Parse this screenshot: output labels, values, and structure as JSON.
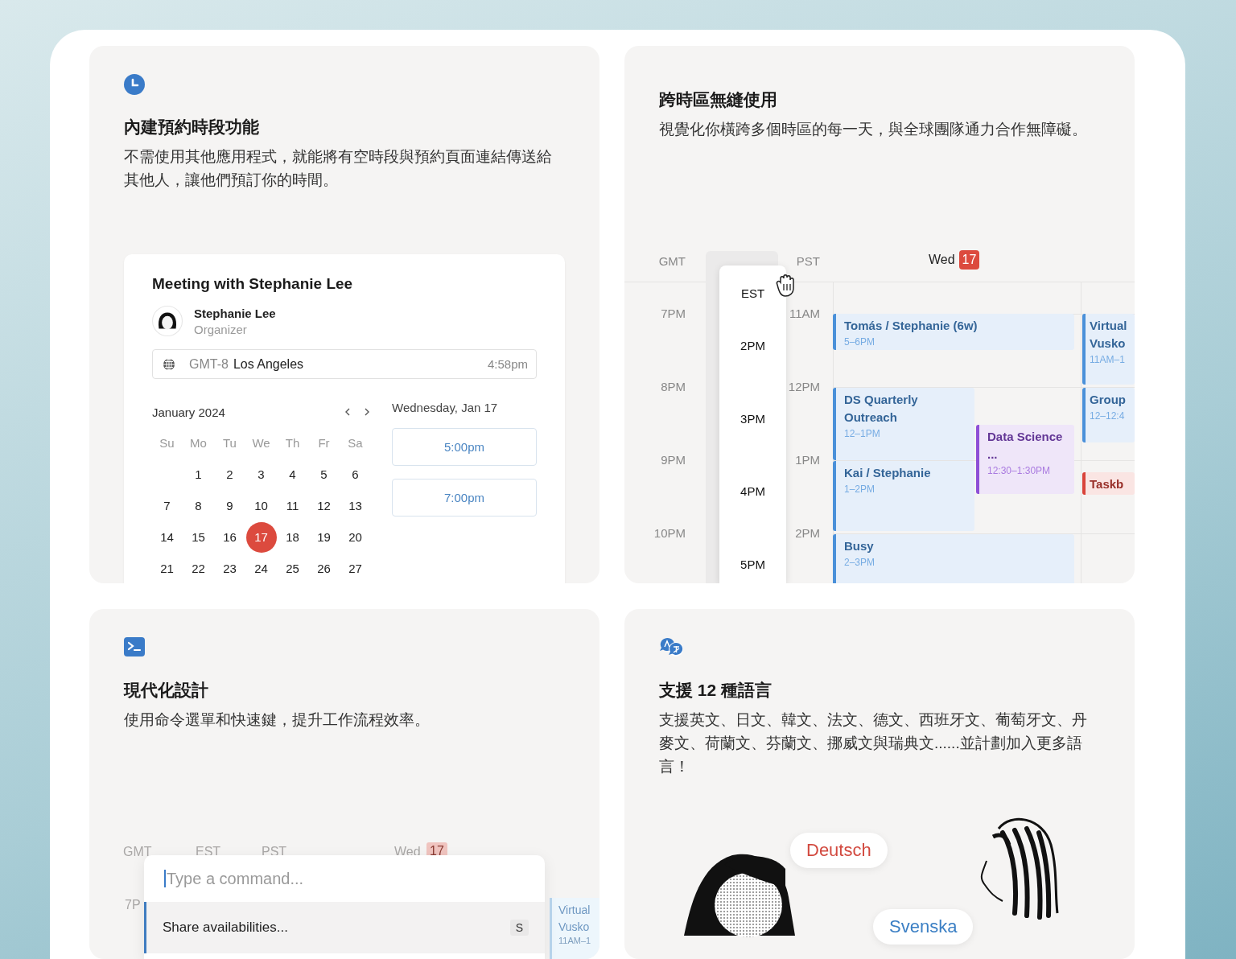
{
  "booking": {
    "title": "內建預約時段功能",
    "description": "不需使用其他應用程式，就能將有空時段與預約頁面連結傳送給其他人，讓他們預訂你的時間。",
    "widget": {
      "title": "Meeting with Stephanie Lee",
      "organizer": {
        "name": "Stephanie Lee",
        "role": "Organizer"
      },
      "timezone": {
        "offset": "GMT-8",
        "city": "Los Angeles",
        "time": "4:58pm"
      },
      "month": "January 2024",
      "weekdays": [
        "Su",
        "Mo",
        "Tu",
        "We",
        "Th",
        "Fr",
        "Sa"
      ],
      "weeks": [
        [
          {
            "label": "1",
            "selected": false
          },
          {
            "label": "2",
            "selected": false
          },
          {
            "label": "3",
            "selected": false
          },
          {
            "label": "4",
            "selected": false
          },
          {
            "label": "5",
            "selected": false
          },
          {
            "label": "6",
            "selected": false
          }
        ],
        [
          {
            "label": "7",
            "selected": false
          },
          {
            "label": "8",
            "selected": false
          },
          {
            "label": "9",
            "selected": false
          },
          {
            "label": "10",
            "selected": false
          },
          {
            "label": "11",
            "selected": false
          },
          {
            "label": "12",
            "selected": false
          },
          {
            "label": "13",
            "selected": false
          }
        ],
        [
          {
            "label": "14",
            "selected": false
          },
          {
            "label": "15",
            "selected": false
          },
          {
            "label": "16",
            "selected": false
          },
          {
            "label": "17",
            "selected": true
          },
          {
            "label": "18",
            "selected": false
          },
          {
            "label": "19",
            "selected": false
          },
          {
            "label": "20",
            "selected": false
          }
        ],
        [
          {
            "label": "21",
            "selected": false
          },
          {
            "label": "22",
            "selected": false
          },
          {
            "label": "23",
            "selected": false
          },
          {
            "label": "24",
            "selected": false
          },
          {
            "label": "25",
            "selected": false
          },
          {
            "label": "26",
            "selected": false
          },
          {
            "label": "27",
            "selected": false
          }
        ]
      ],
      "date_heading": "Wednesday, Jan 17",
      "slots": [
        "5:00pm",
        "7:00pm"
      ]
    }
  },
  "timezones": {
    "title": "跨時區無縫使用",
    "description": "視覺化你橫跨多個時區的每一天，與全球團隊通力合作無障礙。",
    "calendar": {
      "gmt": {
        "label": "GMT",
        "hours": [
          "7PM",
          "8PM",
          "9PM",
          "10PM"
        ]
      },
      "est": {
        "label": "EST",
        "hours": [
          "2PM",
          "3PM",
          "4PM",
          "5PM"
        ]
      },
      "pst": {
        "label": "PST",
        "hours": [
          "11AM",
          "12PM",
          "1PM",
          "2PM"
        ]
      },
      "day": {
        "name": "Wed",
        "date": "17"
      },
      "events": [
        {
          "title": "Tomás / Stephanie (6w)",
          "time": "5–6PM",
          "color": "#4a90d9"
        },
        {
          "title": "DS Quarterly Outreach",
          "time": "12–1PM",
          "color": "#4a90d9"
        },
        {
          "title": "Data Science ...",
          "time": "12:30–1:30PM",
          "color": "#8e4fd6"
        },
        {
          "title": "Kai / Stephanie",
          "time": "1–2PM",
          "color": "#4a90d9"
        },
        {
          "title": "Busy",
          "time": "2–3PM",
          "color": "#4a90d9"
        },
        {
          "title": "Virtual Vusko",
          "time": "11AM–1",
          "color": "#4a90d9"
        },
        {
          "title": "Group",
          "time": "12–12:4",
          "color": "#4a90d9"
        },
        {
          "title": "Taskb",
          "color": "#d9433a"
        }
      ]
    }
  },
  "command": {
    "title": "現代化設計",
    "description": "使用命令選單和快速鍵，提升工作流程效率。",
    "background": {
      "zones": [
        "GMT",
        "EST",
        "PST"
      ],
      "day": {
        "name": "Wed",
        "date": "17"
      },
      "hour": "7P",
      "event": {
        "title": "Virtual Vusko",
        "time": "11AM–1"
      }
    },
    "palette": {
      "placeholder": "Type a command...",
      "items": [
        {
          "label": "Share availabilities...",
          "shortcut": "S",
          "selected": true
        }
      ]
    }
  },
  "languages": {
    "title": "支援 12 種語言",
    "description": "支援英文、日文、韓文、法文、德文、西班牙文、葡萄牙文、丹麥文、荷蘭文、芬蘭文、挪威文與瑞典文......並計劃加入更多語言！",
    "bubbles": [
      {
        "label": "Deutsch",
        "color": "#d2493f"
      },
      {
        "label": "Svenska",
        "color": "#3b7fc4"
      }
    ]
  }
}
